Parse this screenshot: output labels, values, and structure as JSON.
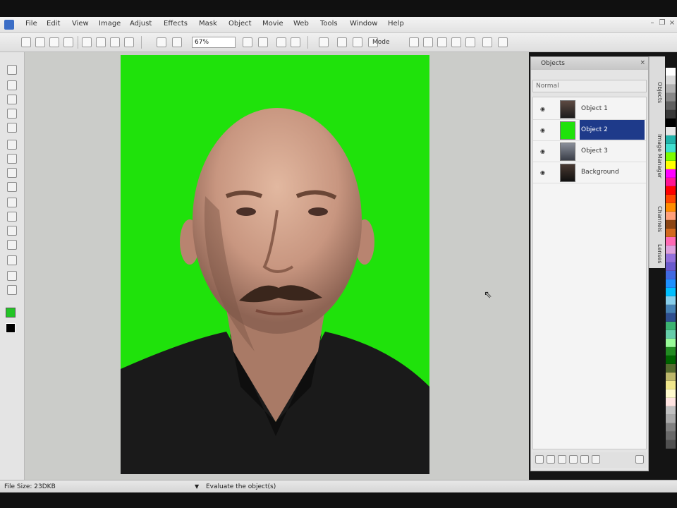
{
  "menu": {
    "items": [
      "File",
      "Edit",
      "View",
      "Image",
      "Adjust",
      "Effects",
      "Mask",
      "Object",
      "Movie",
      "Web",
      "Tools",
      "Window",
      "Help"
    ]
  },
  "toolbar": {
    "zoom_value": "67%",
    "mode_label": "Mode"
  },
  "objects_panel": {
    "title": "Objects",
    "close": "×",
    "options_label": "Normal",
    "layers": [
      {
        "name": "Object 1",
        "thumb": "portrait",
        "selected": false
      },
      {
        "name": "Object 2",
        "thumb": "green",
        "selected": true
      },
      {
        "name": "Object 3",
        "thumb": "dark",
        "selected": false
      },
      {
        "name": "Background",
        "thumb": "portrait",
        "selected": false
      }
    ]
  },
  "docker_tabs": [
    "Objects",
    "Image Manager",
    "Channels",
    "Lenses"
  ],
  "status": {
    "file_size": "File Size: 23DKB",
    "hint": "Evaluate the object(s)"
  },
  "colors": {
    "canvas_background": "#1fe20b",
    "selection": "#1e3a8a",
    "workspace": "#cbccc9"
  },
  "icons": {
    "cursor": "pointer-cursor-icon",
    "visibility": "eye-icon"
  }
}
